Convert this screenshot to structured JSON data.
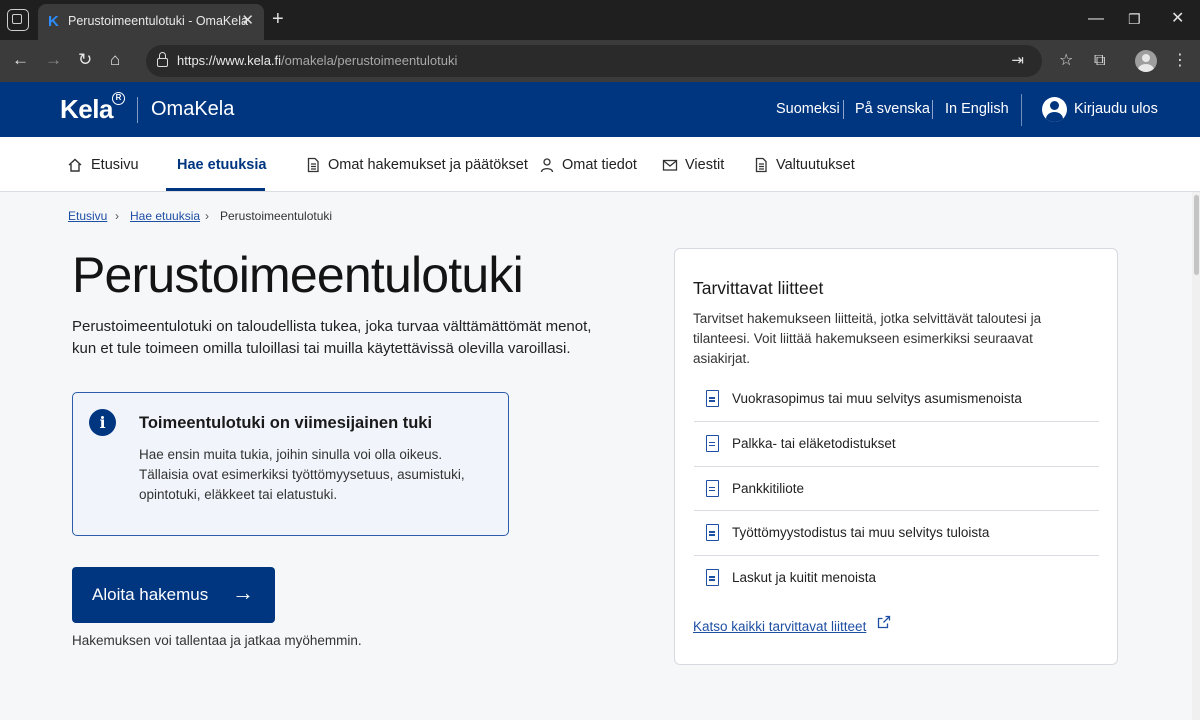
{
  "browser": {
    "tab_title": "Perustoimeentulotuki - OmaKela",
    "tab_favicon_letter": "K",
    "url_host": "https://www.kela.fi",
    "url_path": "/omakela/perustoimeentulotuki",
    "icons": [
      "tab-actions-icon",
      "close-icon",
      "new-tab-icon",
      "minimize-icon",
      "maximize-icon",
      "window-close-icon",
      "back-icon",
      "forward-icon",
      "refresh-icon",
      "home-icon",
      "lock-icon",
      "open-in-app-icon",
      "favorite-icon",
      "collections-icon",
      "profile-icon",
      "more-icon"
    ]
  },
  "header": {
    "logo": "Kela",
    "logo_mark": "R",
    "app_name": "OmaKela",
    "languages": [
      "Suomeksi",
      "På svenska",
      "In English"
    ],
    "logout": "Kirjaudu ulos",
    "color": "#003580"
  },
  "nav": {
    "items": [
      {
        "label": "Etusivu",
        "icon": "home-icon"
      },
      {
        "label": "Hae etuuksia",
        "active": true
      },
      {
        "label": "Omat hakemukset ja päätökset",
        "icon": "document-icon"
      },
      {
        "label": "Omat tiedot",
        "icon": "person-icon"
      },
      {
        "label": "Viestit",
        "icon": "mail-icon"
      },
      {
        "label": "Valtuutukset",
        "icon": "document-icon"
      }
    ]
  },
  "breadcrumb": [
    "Etusivu",
    "Hae etuuksia",
    "Perustoimeentulotuki"
  ],
  "main": {
    "title": "Perustoimeentulotuki",
    "lead": "Perustoimeentulotuki on taloudellista tukea, joka turvaa välttämättömät menot, kun et tule toimeen omilla tuloillasi tai muilla käytettävissä olevilla varoillasi.",
    "info_title": "Toimeentulotuki on viimesijainen tuki",
    "info_body": "Hae ensin muita tukia, joihin sinulla voi olla oikeus. Tällaisia ovat esimerkiksi työttömyysetuus, asumistuki, opintotuki, eläkkeet tai elatustuki.",
    "start_button": "Aloita hakemus",
    "save_note": "Hakemuksen voi tallentaa ja jatkaa myöhemmin."
  },
  "side": {
    "title": "Tarvittavat liitteet",
    "desc": "Tarvitset hakemukseen liitteitä, jotka selvittävät taloutesi ja tilanteesi. Voit liittää hakemukseen esimerkiksi seuraavat asiakirjat.",
    "attachments": [
      "Vuokrasopimus tai muu selvitys asumismenoista",
      "Palkka- tai eläketodistukset",
      "Pankkitiliote",
      "Työttömyystodistus tai muu selvitys tuloista",
      "Laskut ja kuitit menoista"
    ],
    "link": "Katso kaikki tarvittavat liitteet"
  }
}
